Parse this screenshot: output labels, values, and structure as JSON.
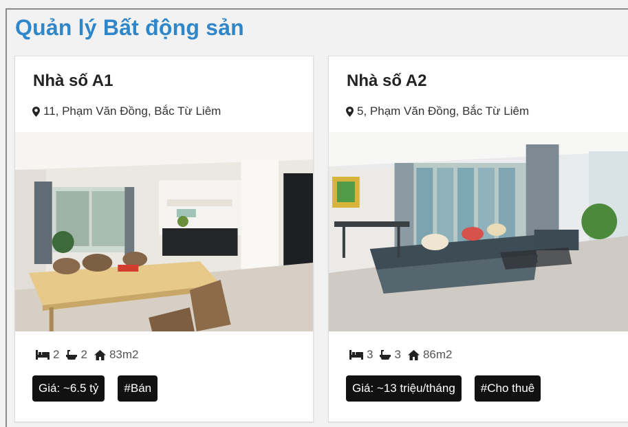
{
  "app": {
    "title": "Quản lý Bất động sản"
  },
  "listings": [
    {
      "title": "Nhà số A1",
      "address": "11, Phạm Văn Đồng, Bắc Từ Liêm",
      "bedrooms": "2",
      "bathrooms": "2",
      "area": "83m2",
      "price_tag": "Giá: ~6.5 tỷ",
      "type_tag": "#Bán"
    },
    {
      "title": "Nhà số A2",
      "address": "5, Phạm Văn Đồng, Bắc Từ Liêm",
      "bedrooms": "3",
      "bathrooms": "3",
      "area": "86m2",
      "price_tag": "Giá: ~13 triệu/tháng",
      "type_tag": "#Cho thuê"
    }
  ],
  "icons": {
    "address": "map-marker-icon",
    "bedrooms": "bed-icon",
    "bathrooms": "bath-icon",
    "area": "home-icon"
  },
  "colors": {
    "title": "#2f86c8",
    "tag_background": "#111111",
    "tag_text": "#ffffff"
  }
}
